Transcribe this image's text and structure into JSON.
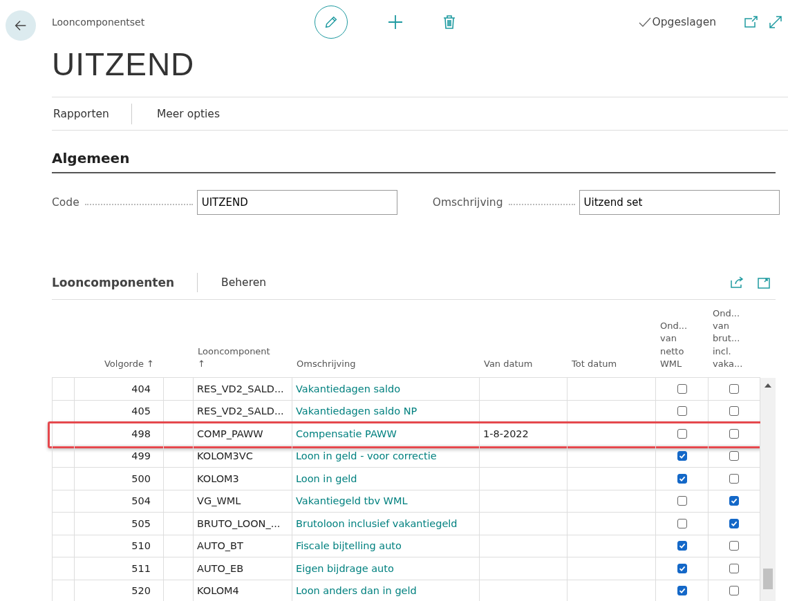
{
  "header": {
    "breadcrumb": "Looncomponentset",
    "status": "Opgeslagen",
    "title": "UITZEND"
  },
  "action_bar": [
    "Rapporten",
    "Meer opties"
  ],
  "general": {
    "heading": "Algemeen",
    "fields": [
      {
        "label": "Code",
        "value": "UITZEND"
      },
      {
        "label": "Omschrijving",
        "value": "Uitzend set"
      }
    ]
  },
  "lines": {
    "heading": "Looncomponenten",
    "action": "Beheren",
    "columns": [
      {
        "kind": "number",
        "label": "Volgorde ↑"
      },
      {
        "kind": "code",
        "label": "Looncomponent ↑"
      },
      {
        "kind": "text",
        "label": "Omschrijving"
      },
      {
        "kind": "date",
        "label": "Van datum"
      },
      {
        "kind": "date",
        "label": "Tot datum"
      },
      {
        "kind": "check",
        "label": "Ond... van netto WML"
      },
      {
        "kind": "check",
        "label": "Ond... van brut... incl. vaka..."
      }
    ],
    "rows": [
      {
        "volgorde": "404",
        "code": "RES_VD2_SALD...",
        "description": "Vakantiedagen saldo",
        "netto_wml": false,
        "bruto_incl": false,
        "highlighted": false
      },
      {
        "volgorde": "405",
        "code": "RES_VD2_SALD...",
        "description": "Vakantiedagen saldo NP",
        "netto_wml": false,
        "bruto_incl": false,
        "highlighted": false
      },
      {
        "volgorde": "498",
        "code": "COMP_PAWW",
        "description": "Compensatie PAWW",
        "van_datum": "1-8-2022",
        "netto_wml": false,
        "bruto_incl": false,
        "highlighted": true
      },
      {
        "volgorde": "499",
        "code": "KOLOM3VC",
        "description": "Loon in geld - voor correctie",
        "netto_wml": true,
        "bruto_incl": false,
        "highlighted": false
      },
      {
        "volgorde": "500",
        "code": "KOLOM3",
        "description": "Loon in geld",
        "netto_wml": true,
        "bruto_incl": false,
        "highlighted": false
      },
      {
        "volgorde": "504",
        "code": "VG_WML",
        "description": "Vakantiegeld tbv WML",
        "netto_wml": false,
        "bruto_incl": true,
        "highlighted": false
      },
      {
        "volgorde": "505",
        "code": "BRUTO_LOON_...",
        "description": "Brutoloon inclusief vakantiegeld",
        "netto_wml": false,
        "bruto_incl": true,
        "highlighted": false
      },
      {
        "volgorde": "510",
        "code": "AUTO_BT",
        "description": "Fiscale bijtelling auto",
        "netto_wml": true,
        "bruto_incl": false,
        "highlighted": false
      },
      {
        "volgorde": "511",
        "code": "AUTO_EB",
        "description": "Eigen bijdrage auto",
        "netto_wml": true,
        "bruto_incl": false,
        "highlighted": false
      },
      {
        "volgorde": "520",
        "code": "KOLOM4",
        "description": "Loon anders dan in geld",
        "netto_wml": true,
        "bruto_incl": false,
        "highlighted": false
      }
    ]
  }
}
